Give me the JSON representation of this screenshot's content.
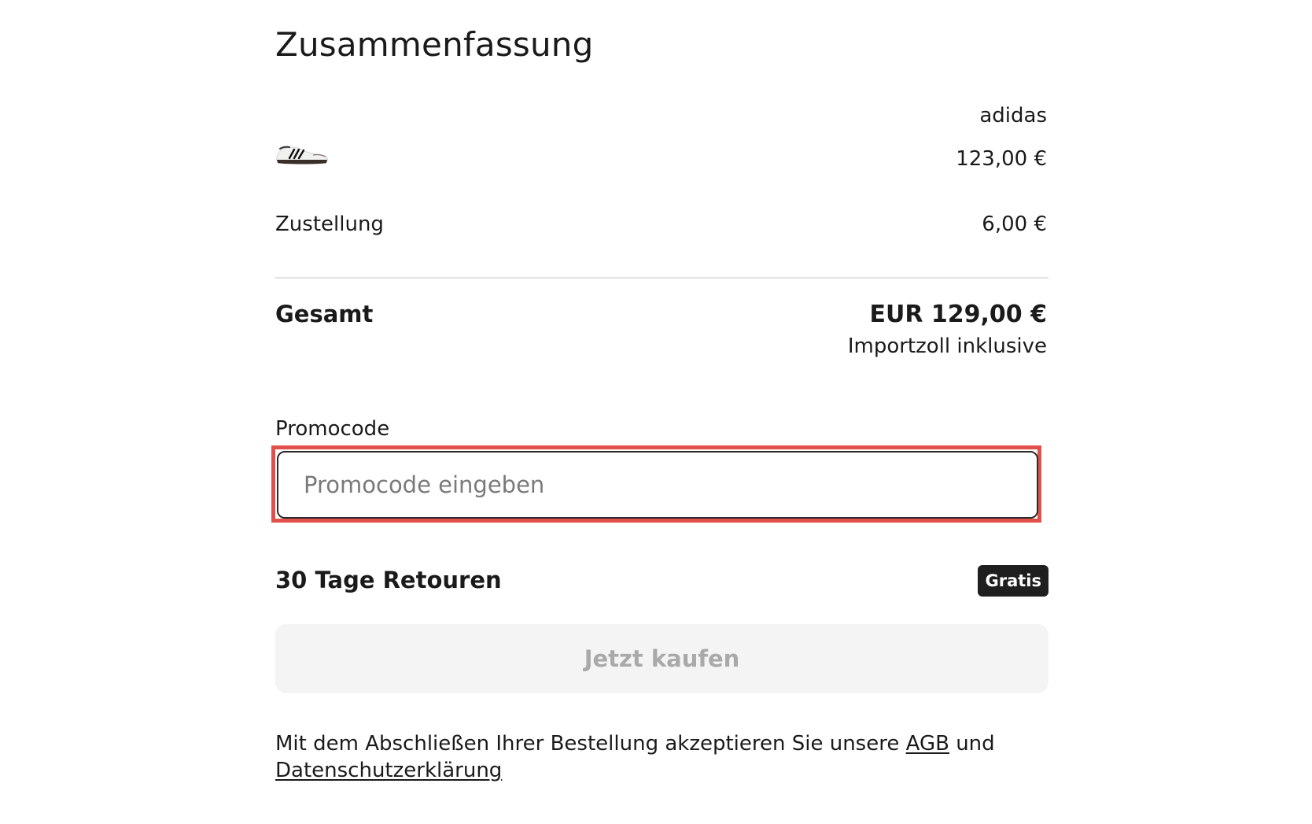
{
  "summary": {
    "title": "Zusammenfassung",
    "product": {
      "brand": "adidas",
      "price": "123,00 €",
      "thumbnail_icon": "sneaker-thumbnail"
    },
    "delivery": {
      "label": "Zustellung",
      "value": "6,00 €"
    },
    "total": {
      "label": "Gesamt",
      "value": "EUR 129,00 €",
      "note": "Importzoll inklusive"
    },
    "promo": {
      "label": "Promocode",
      "placeholder": "Promocode eingeben",
      "value": "",
      "highlight_color": "#e2504a"
    },
    "returns": {
      "label": "30 Tage Retouren",
      "badge": "Gratis"
    },
    "buy_button": {
      "label": "Jetzt kaufen",
      "disabled": true
    },
    "legal": {
      "text_before": "Mit dem Abschließen Ihrer Bestellung akzeptieren Sie unsere ",
      "agb_link": "AGB",
      "text_middle": " und ",
      "privacy_link": "Datenschutzerklärung"
    }
  }
}
